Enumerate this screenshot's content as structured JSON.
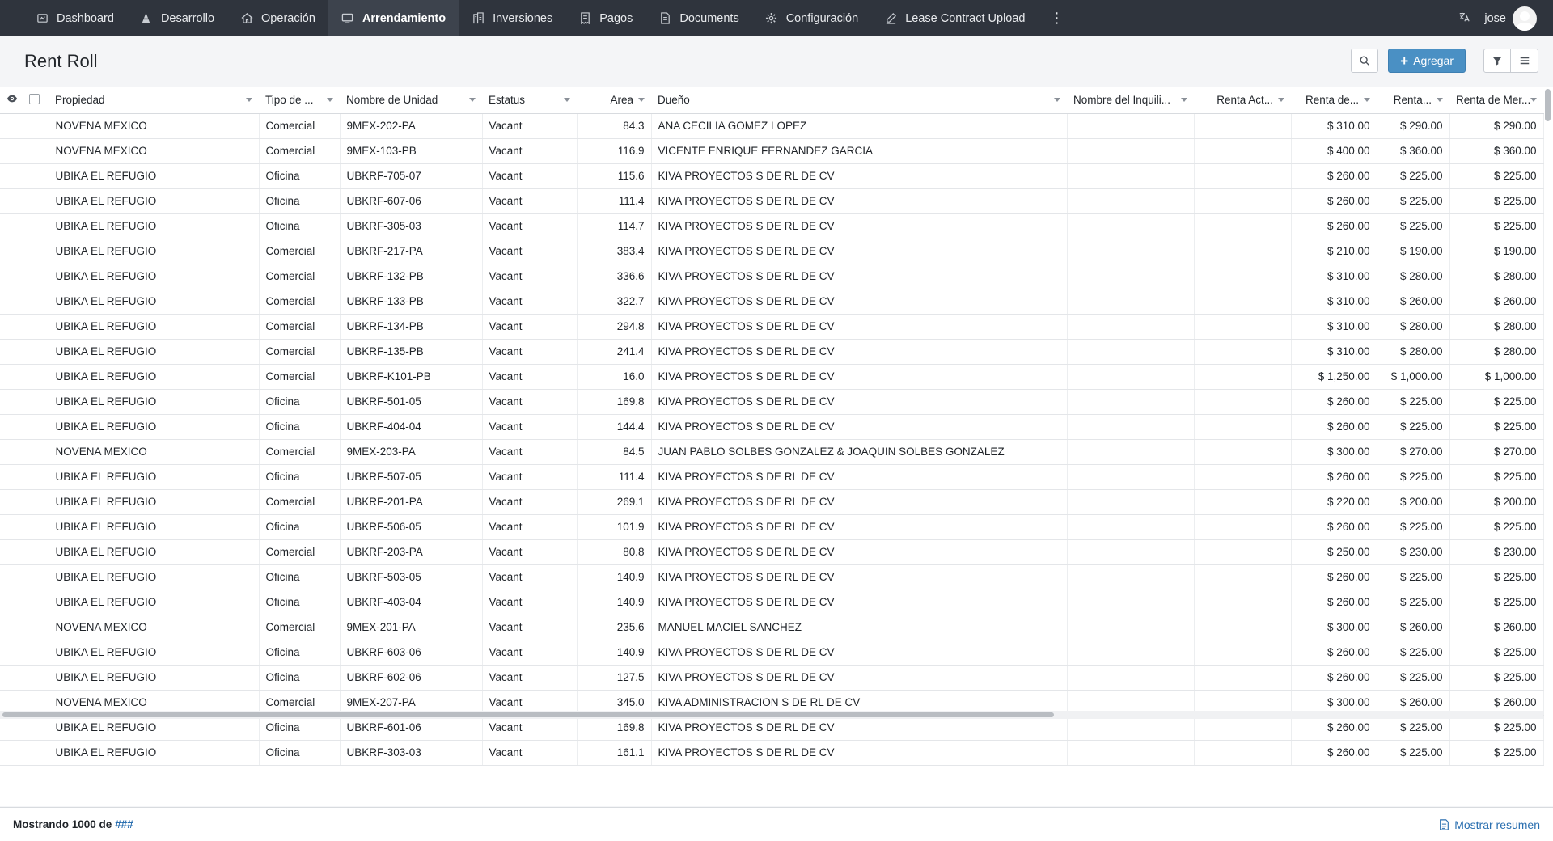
{
  "nav": {
    "items": [
      {
        "label": "Dashboard",
        "icon": "dashboard-icon"
      },
      {
        "label": "Desarrollo",
        "icon": "construction-icon"
      },
      {
        "label": "Operación",
        "icon": "home-icon"
      },
      {
        "label": "Arrendamiento",
        "icon": "monitor-icon",
        "active": true
      },
      {
        "label": "Inversiones",
        "icon": "building-icon"
      },
      {
        "label": "Pagos",
        "icon": "receipt-icon"
      },
      {
        "label": "Documents",
        "icon": "document-icon"
      },
      {
        "label": "Configuración",
        "icon": "gear-icon"
      },
      {
        "label": "Lease Contract Upload",
        "icon": "pen-icon"
      }
    ],
    "more": "⋮",
    "user": "jose"
  },
  "page": {
    "title": "Rent Roll",
    "add_label": "Agregar"
  },
  "table": {
    "columns": [
      "Propiedad",
      "Tipo de ...",
      "Nombre de Unidad",
      "Estatus",
      "Area",
      "Dueño",
      "Nombre del Inquili...",
      "Renta Act...",
      "Renta de...",
      "Renta...",
      "Renta de Mer..."
    ],
    "rows": [
      [
        "NOVENA MEXICO",
        "Comercial",
        "9MEX-202-PA",
        "Vacant",
        "84.3",
        "ANA CECILIA GOMEZ LOPEZ",
        "",
        "",
        "$ 310.00",
        "$ 290.00",
        "$ 290.00"
      ],
      [
        "NOVENA MEXICO",
        "Comercial",
        "9MEX-103-PB",
        "Vacant",
        "116.9",
        "VICENTE ENRIQUE FERNANDEZ GARCIA",
        "",
        "",
        "$ 400.00",
        "$ 360.00",
        "$ 360.00"
      ],
      [
        "UBIKA EL REFUGIO",
        "Oficina",
        "UBKRF-705-07",
        "Vacant",
        "115.6",
        "KIVA PROYECTOS S DE RL DE CV",
        "",
        "",
        "$ 260.00",
        "$ 225.00",
        "$ 225.00"
      ],
      [
        "UBIKA EL REFUGIO",
        "Oficina",
        "UBKRF-607-06",
        "Vacant",
        "111.4",
        "KIVA PROYECTOS S DE RL DE CV",
        "",
        "",
        "$ 260.00",
        "$ 225.00",
        "$ 225.00"
      ],
      [
        "UBIKA EL REFUGIO",
        "Oficina",
        "UBKRF-305-03",
        "Vacant",
        "114.7",
        "KIVA PROYECTOS S DE RL DE CV",
        "",
        "",
        "$ 260.00",
        "$ 225.00",
        "$ 225.00"
      ],
      [
        "UBIKA EL REFUGIO",
        "Comercial",
        "UBKRF-217-PA",
        "Vacant",
        "383.4",
        "KIVA PROYECTOS S DE RL DE CV",
        "",
        "",
        "$ 210.00",
        "$ 190.00",
        "$ 190.00"
      ],
      [
        "UBIKA EL REFUGIO",
        "Comercial",
        "UBKRF-132-PB",
        "Vacant",
        "336.6",
        "KIVA PROYECTOS S DE RL DE CV",
        "",
        "",
        "$ 310.00",
        "$ 280.00",
        "$ 280.00"
      ],
      [
        "UBIKA EL REFUGIO",
        "Comercial",
        "UBKRF-133-PB",
        "Vacant",
        "322.7",
        "KIVA PROYECTOS S DE RL DE CV",
        "",
        "",
        "$ 310.00",
        "$ 260.00",
        "$ 260.00"
      ],
      [
        "UBIKA EL REFUGIO",
        "Comercial",
        "UBKRF-134-PB",
        "Vacant",
        "294.8",
        "KIVA PROYECTOS S DE RL DE CV",
        "",
        "",
        "$ 310.00",
        "$ 280.00",
        "$ 280.00"
      ],
      [
        "UBIKA EL REFUGIO",
        "Comercial",
        "UBKRF-135-PB",
        "Vacant",
        "241.4",
        "KIVA PROYECTOS S DE RL DE CV",
        "",
        "",
        "$ 310.00",
        "$ 280.00",
        "$ 280.00"
      ],
      [
        "UBIKA EL REFUGIO",
        "Comercial",
        "UBKRF-K101-PB",
        "Vacant",
        "16.0",
        "KIVA PROYECTOS S DE RL DE CV",
        "",
        "",
        "$ 1,250.00",
        "$ 1,000.00",
        "$ 1,000.00"
      ],
      [
        "UBIKA EL REFUGIO",
        "Oficina",
        "UBKRF-501-05",
        "Vacant",
        "169.8",
        "KIVA PROYECTOS S DE RL DE CV",
        "",
        "",
        "$ 260.00",
        "$ 225.00",
        "$ 225.00"
      ],
      [
        "UBIKA EL REFUGIO",
        "Oficina",
        "UBKRF-404-04",
        "Vacant",
        "144.4",
        "KIVA PROYECTOS S DE RL DE CV",
        "",
        "",
        "$ 260.00",
        "$ 225.00",
        "$ 225.00"
      ],
      [
        "NOVENA MEXICO",
        "Comercial",
        "9MEX-203-PA",
        "Vacant",
        "84.5",
        "JUAN PABLO SOLBES GONZALEZ & JOAQUIN SOLBES GONZALEZ",
        "",
        "",
        "$ 300.00",
        "$ 270.00",
        "$ 270.00"
      ],
      [
        "UBIKA EL REFUGIO",
        "Oficina",
        "UBKRF-507-05",
        "Vacant",
        "111.4",
        "KIVA PROYECTOS S DE RL DE CV",
        "",
        "",
        "$ 260.00",
        "$ 225.00",
        "$ 225.00"
      ],
      [
        "UBIKA EL REFUGIO",
        "Comercial",
        "UBKRF-201-PA",
        "Vacant",
        "269.1",
        "KIVA PROYECTOS S DE RL DE CV",
        "",
        "",
        "$ 220.00",
        "$ 200.00",
        "$ 200.00"
      ],
      [
        "UBIKA EL REFUGIO",
        "Oficina",
        "UBKRF-506-05",
        "Vacant",
        "101.9",
        "KIVA PROYECTOS S DE RL DE CV",
        "",
        "",
        "$ 260.00",
        "$ 225.00",
        "$ 225.00"
      ],
      [
        "UBIKA EL REFUGIO",
        "Comercial",
        "UBKRF-203-PA",
        "Vacant",
        "80.8",
        "KIVA PROYECTOS S DE RL DE CV",
        "",
        "",
        "$ 250.00",
        "$ 230.00",
        "$ 230.00"
      ],
      [
        "UBIKA EL REFUGIO",
        "Oficina",
        "UBKRF-503-05",
        "Vacant",
        "140.9",
        "KIVA PROYECTOS S DE RL DE CV",
        "",
        "",
        "$ 260.00",
        "$ 225.00",
        "$ 225.00"
      ],
      [
        "UBIKA EL REFUGIO",
        "Oficina",
        "UBKRF-403-04",
        "Vacant",
        "140.9",
        "KIVA PROYECTOS S DE RL DE CV",
        "",
        "",
        "$ 260.00",
        "$ 225.00",
        "$ 225.00"
      ],
      [
        "NOVENA MEXICO",
        "Comercial",
        "9MEX-201-PA",
        "Vacant",
        "235.6",
        "MANUEL MACIEL SANCHEZ",
        "",
        "",
        "$ 300.00",
        "$ 260.00",
        "$ 260.00"
      ],
      [
        "UBIKA EL REFUGIO",
        "Oficina",
        "UBKRF-603-06",
        "Vacant",
        "140.9",
        "KIVA PROYECTOS S DE RL DE CV",
        "",
        "",
        "$ 260.00",
        "$ 225.00",
        "$ 225.00"
      ],
      [
        "UBIKA EL REFUGIO",
        "Oficina",
        "UBKRF-602-06",
        "Vacant",
        "127.5",
        "KIVA PROYECTOS S DE RL DE CV",
        "",
        "",
        "$ 260.00",
        "$ 225.00",
        "$ 225.00"
      ],
      [
        "NOVENA MEXICO",
        "Comercial",
        "9MEX-207-PA",
        "Vacant",
        "345.0",
        "KIVA ADMINISTRACION S DE RL DE CV",
        "",
        "",
        "$ 300.00",
        "$ 260.00",
        "$ 260.00"
      ],
      [
        "UBIKA EL REFUGIO",
        "Oficina",
        "UBKRF-601-06",
        "Vacant",
        "169.8",
        "KIVA PROYECTOS S DE RL DE CV",
        "",
        "",
        "$ 260.00",
        "$ 225.00",
        "$ 225.00"
      ],
      [
        "UBIKA EL REFUGIO",
        "Oficina",
        "UBKRF-303-03",
        "Vacant",
        "161.1",
        "KIVA PROYECTOS S DE RL DE CV",
        "",
        "",
        "$ 260.00",
        "$ 225.00",
        "$ 225.00"
      ]
    ]
  },
  "footer": {
    "showing_prefix": "Mostrando 1000 de",
    "total": "###",
    "summary_label": "Mostrar resumen"
  }
}
